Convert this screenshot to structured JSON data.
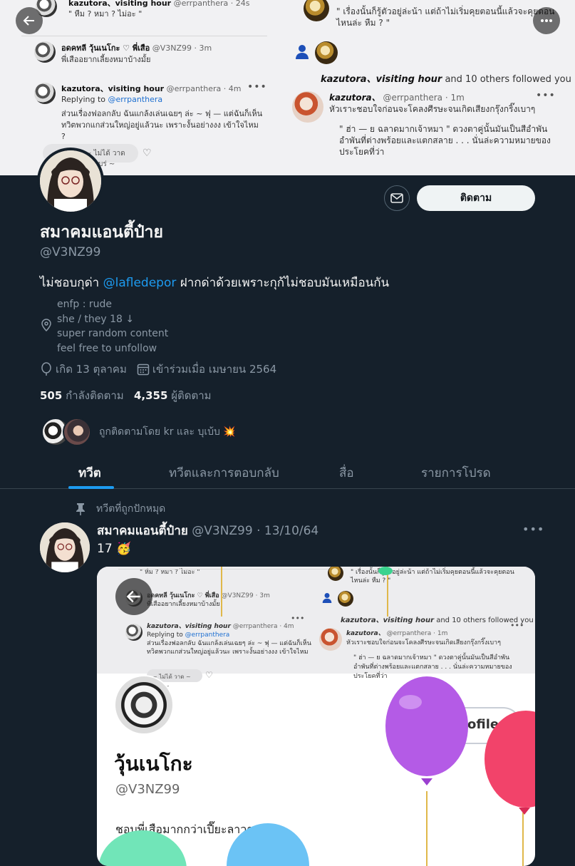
{
  "banner": {
    "left_rows": [
      {
        "name": "kazutora、visiting hour",
        "handle": "@errpanthera · 24s",
        "text": "\" หืม ? หมา ? ไม่อะ \""
      },
      {
        "name": "อดคทลี วุ้นเนโกะ ♡ พี่เสือ",
        "handle": "@V3NZ99 · 3m",
        "text": "พี่เสืออยากเลี้ยงหมาบ้างมั้ย"
      },
      {
        "name": "kazutora、visiting hour",
        "handle": "@errpanthera · 4m",
        "replying_prefix": "Replying to",
        "replying_to": "@errpanthera",
        "text1": "ส่วนเรื่องฟอลกลับ ฉันแกล้งเล่นเฉยๆ ล่ะ ~ ฟุ — แต่ฉันก็เห็น",
        "text2": "ทวิตพวกแกส่วนใหญ่อยู่แล้วนะ เพราะงั้นอย่างงง เข้าใจไหม",
        "text3": "?"
      }
    ],
    "chip": "~ ไม่ได้ วาด ~ แบร่ ~",
    "right_rows": {
      "top_text1": "\" เรื่องนั้นก็รู้ตัวอยู่ล่ะน้า แต่ถ้าไม่เริ่มคุยตอนนี้แล้วจะคุยตอน",
      "top_text2": "ไหนล่ะ หืม ? \"",
      "followed": "kazutora、visiting hour",
      "followed_suffix": "and 10 others followed you",
      "name": "kazutora、",
      "handle": "@errpanthera · 1m",
      "text1": "หัวเราะชอบใจก่อนจะโคลงศีรษะจนเกิดเสียงกรุ๊งกริ๊งเบาๆ",
      "text2": "\" ฮ่า — ย ฉลาดมากเจ้าหมา \" ดวงตาคู่นั้นมันเป็นสีอำพัน",
      "text3": "อำพันที่ต่างพร้อยและแตกสลาย . . . นั่นล่ะความหมายของ",
      "text4": "ประโยคที่ว่า"
    }
  },
  "icons": {
    "back": "back-arrow-icon",
    "more": "more-icon",
    "mail": "mail-icon",
    "location": "location-icon",
    "birthday": "balloon-icon",
    "calendar": "calendar-icon",
    "pin": "pin-icon"
  },
  "profile": {
    "follow_label": "ติดตาม",
    "display_name": "สมาคมแอนตี้ป๋าย",
    "handle": "@V3NZ99",
    "bio_prefix": "ไม่ชอบกุด่า",
    "bio_mention": "@lafledepor",
    "bio_suffix": "ฝากด่าด้วยเพราะกุก้ไม่ชอบมันเหมือนกัน",
    "location_lines": [
      "enfp : rude",
      "she / they 18 ↓",
      "super random content",
      "feel free to unfollow"
    ],
    "birthday": "เกิด 13 ตุลาคม",
    "joined": "เข้าร่วมเมื่อ เมษายน 2564",
    "following_count": "505",
    "following_label": "กำลังติดตาม",
    "followers_count": "4,355",
    "followers_label": "ผู้ติดตาม",
    "followed_by": "ถูกติดตามโดย kr และ บุเบ้บ 💥"
  },
  "tabs": [
    "ทวีต",
    "ทวีตและการตอบกลับ",
    "สื่อ",
    "รายการโปรด"
  ],
  "tweet": {
    "pinned_label": "ทวีตที่ถูกปักหมุด",
    "name": "สมาคมแอนตี้ป๋าย",
    "handle_date": "@V3NZ99 · 13/10/64",
    "text": "17 🥳",
    "media": {
      "top_text1": "\" หืม ? หมา ? ไม่อะ \"",
      "top_row_name": "อดคทลี วุ้นเนโกะ ♡ พี่เสือ",
      "top_row_handle": "@V3NZ99 · 3m",
      "top_row_text": "พี่เสืออยากเลี้ยงหมาบ้างมั้ย",
      "reply_name": "kazutora、visiting hour",
      "reply_handle": "@errpanthera · 4m",
      "reply_prefix": "Replying to",
      "reply_to": "@errpanthera",
      "reply_text1": "ส่วนเรื่องฟอลกลับ ฉันแกล้งเล่นเฉยๆ ล่ะ ~ ฟุ — แต่ฉันก็เห็น",
      "reply_text2": "ทวิตพวกแกส่วนใหญ่อยู่แล้วนะ เพราะงั้นอย่างงง เข้าใจไหม",
      "chip": "~ ไม่ได้ วาด ~ แบร่ ~",
      "right_top1": "\" เรื่องนั้นก็รู้ตัวอยู่ล่ะน้า แต่ถ้าไม่เริ่มคุยตอนนี้แล้วจะคุยตอน",
      "right_top2": "ไหนล่ะ หืม ? \"",
      "followed": "kazutora、visiting hour",
      "followed_suffix": "and 10 others followed you",
      "r_name": "kazutora、",
      "r_handle": "@errpanthera · 1m",
      "r_text1": "หัวเราะชอบใจก่อนจะโคลงศีรษะจนเกิดเสียงกรุ๊งกริ๊งเบาๆ",
      "r_text2": "\" ฮ่า — ย ฉลาดมากเจ้าหมา \" ดวงตาคู่นั้นมันเป็นสีอำพัน",
      "r_text3": "อำพันที่ต่างพร้อยและแตกสลาย . . . นั่นล่ะความหมายของ",
      "r_text4": "ประโยคที่ว่า",
      "edit_profile": "Edit profile",
      "name": "วุ้นเนโกะ",
      "handle": "@V3NZ99",
      "bio": "ชอบพี่เสือมากกว่าเปี๊ยะลาวา"
    }
  },
  "colors": {
    "background": "#15202b",
    "accent": "#1d9bf0",
    "muted": "#8b98a5",
    "balloon_purple": "#b45be6",
    "balloon_red": "#f2436a",
    "balloon_blue": "#6bc3f5",
    "balloon_green": "#71e5b8"
  }
}
